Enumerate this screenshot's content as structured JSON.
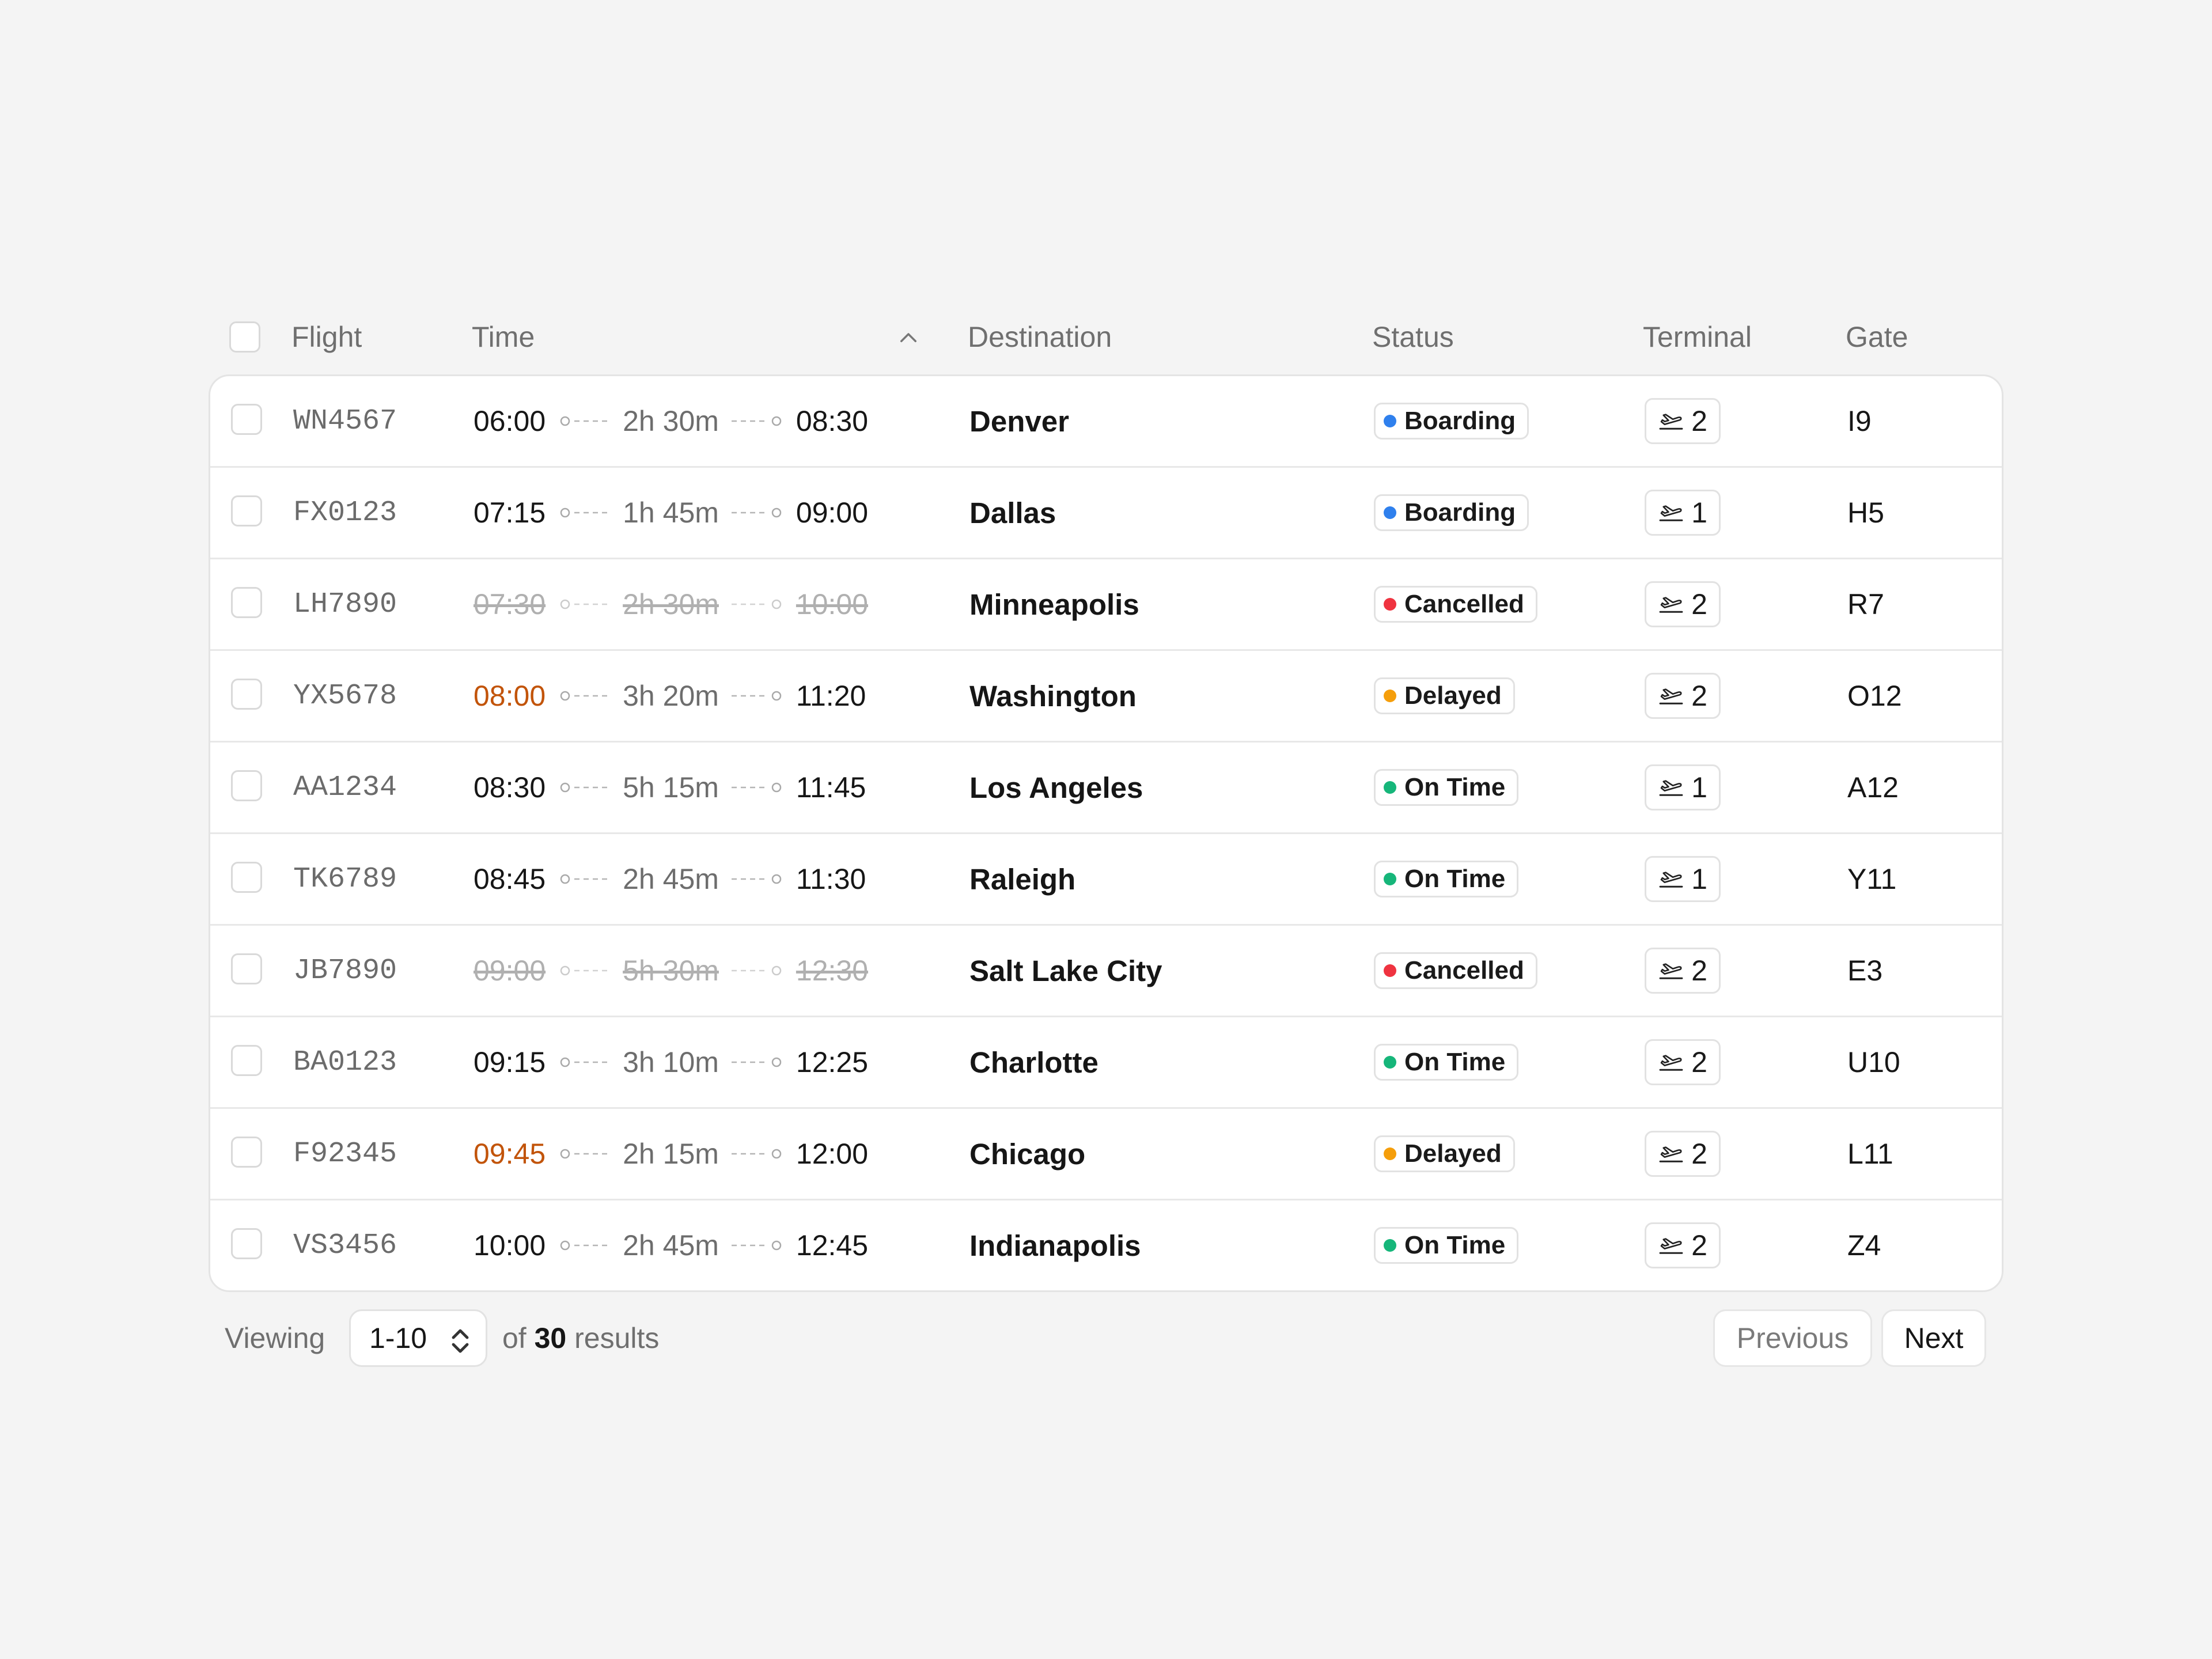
{
  "header": {
    "flight": "Flight",
    "time": "Time",
    "destination": "Destination",
    "status": "Status",
    "terminal": "Terminal",
    "gate": "Gate",
    "sort_icon": "chevron-up-icon"
  },
  "status_colors": {
    "Boarding": "#2f80ed",
    "Cancelled": "#ef3340",
    "Delayed": "#f59e0b",
    "On Time": "#16b67a"
  },
  "rows": [
    {
      "flight": "WN4567",
      "dep": "06:00",
      "duration": "2h 30m",
      "arr": "08:30",
      "destination": "Denver",
      "status": "Boarding",
      "terminal": "2",
      "gate": "I9",
      "dep_delayed": false,
      "cancelled": false
    },
    {
      "flight": "FX0123",
      "dep": "07:15",
      "duration": "1h 45m",
      "arr": "09:00",
      "destination": "Dallas",
      "status": "Boarding",
      "terminal": "1",
      "gate": "H5",
      "dep_delayed": false,
      "cancelled": false
    },
    {
      "flight": "LH7890",
      "dep": "07:30",
      "duration": "2h 30m",
      "arr": "10:00",
      "destination": "Minneapolis",
      "status": "Cancelled",
      "terminal": "2",
      "gate": "R7",
      "dep_delayed": false,
      "cancelled": true
    },
    {
      "flight": "YX5678",
      "dep": "08:00",
      "duration": "3h 20m",
      "arr": "11:20",
      "destination": "Washington",
      "status": "Delayed",
      "terminal": "2",
      "gate": "O12",
      "dep_delayed": true,
      "cancelled": false
    },
    {
      "flight": "AA1234",
      "dep": "08:30",
      "duration": "5h 15m",
      "arr": "11:45",
      "destination": "Los Angeles",
      "status": "On Time",
      "terminal": "1",
      "gate": "A12",
      "dep_delayed": false,
      "cancelled": false
    },
    {
      "flight": "TK6789",
      "dep": "08:45",
      "duration": "2h 45m",
      "arr": "11:30",
      "destination": "Raleigh",
      "status": "On Time",
      "terminal": "1",
      "gate": "Y11",
      "dep_delayed": false,
      "cancelled": false
    },
    {
      "flight": "JB7890",
      "dep": "09:00",
      "duration": "5h 30m",
      "arr": "12:30",
      "destination": "Salt Lake City",
      "status": "Cancelled",
      "terminal": "2",
      "gate": "E3",
      "dep_delayed": false,
      "cancelled": true
    },
    {
      "flight": "BA0123",
      "dep": "09:15",
      "duration": "3h 10m",
      "arr": "12:25",
      "destination": "Charlotte",
      "status": "On Time",
      "terminal": "2",
      "gate": "U10",
      "dep_delayed": false,
      "cancelled": false
    },
    {
      "flight": "F92345",
      "dep": "09:45",
      "duration": "2h 15m",
      "arr": "12:00",
      "destination": "Chicago",
      "status": "Delayed",
      "terminal": "2",
      "gate": "L11",
      "dep_delayed": true,
      "cancelled": false
    },
    {
      "flight": "VS3456",
      "dep": "10:00",
      "duration": "2h 45m",
      "arr": "12:45",
      "destination": "Indianapolis",
      "status": "On Time",
      "terminal": "2",
      "gate": "Z4",
      "dep_delayed": false,
      "cancelled": false
    }
  ],
  "footer": {
    "viewing_label": "Viewing",
    "range_value": "1-10",
    "of_label": "of",
    "total": "30",
    "results_label": "results",
    "previous_label": "Previous",
    "next_label": "Next"
  }
}
